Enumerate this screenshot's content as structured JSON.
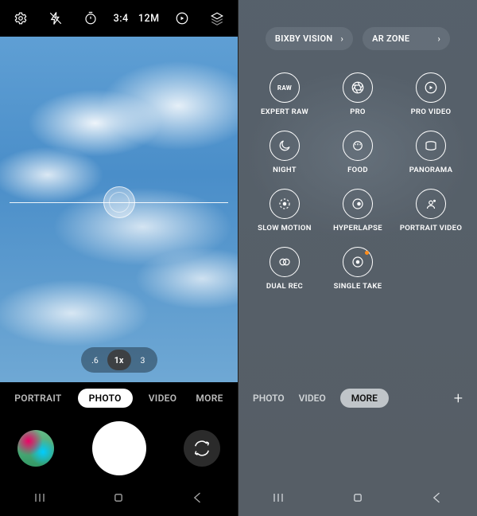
{
  "left": {
    "topbar": {
      "ratio": "3:4",
      "megapixels": "12M"
    },
    "zoom": {
      "wide": ".6",
      "main": "1x",
      "tele": "3"
    },
    "modes": {
      "portrait": "PORTRAIT",
      "photo": "PHOTO",
      "video": "VIDEO",
      "more": "MORE"
    }
  },
  "right": {
    "pills": {
      "bixby": "BIXBY VISION",
      "arzone": "AR ZONE"
    },
    "grid": {
      "expert_raw": "EXPERT RAW",
      "pro": "PRO",
      "pro_video": "PRO VIDEO",
      "night": "NIGHT",
      "food": "FOOD",
      "panorama": "PANORAMA",
      "slow_motion": "SLOW MOTION",
      "hyperlapse": "HYPERLAPSE",
      "portrait_video": "PORTRAIT VIDEO",
      "dual_rec": "DUAL REC",
      "single_take": "SINGLE TAKE",
      "raw_label": "RAW"
    },
    "modes": {
      "photo": "PHOTO",
      "video": "VIDEO",
      "more": "MORE",
      "plus": "+"
    }
  }
}
